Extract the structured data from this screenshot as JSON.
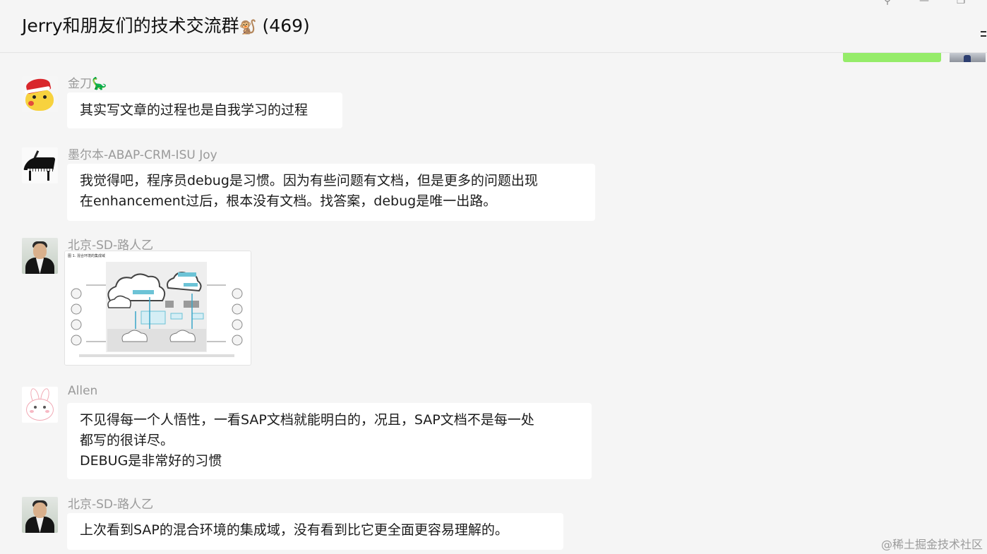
{
  "header": {
    "title": "Jerry和朋友们的技术交流群",
    "emoji": "🐒",
    "member_count": "(469)",
    "controls": {
      "pin": "⚲",
      "minimize": "—",
      "restore": "❐"
    }
  },
  "messages": [
    {
      "sender": "金刀",
      "sender_emoji": "🦕",
      "text": "其实写文章的过程也是自我学习的过程"
    },
    {
      "sender": "墨尔本-ABAP-CRM-ISU Joy",
      "text": "我觉得吧，程序员debug是习惯。因为有些问题有文档，但是更多的问题出现\n在enhancement过后，根本没有文档。找答案，debug是唯一出路。"
    },
    {
      "sender": "北京-SD-路人乙",
      "image_caption": "图 1. 混合环境的集成域"
    },
    {
      "sender": "Allen",
      "text": "不见得每一个人悟性，一看SAP文档就能明白的，况且，SAP文档不是每一处\n都写的很详尽。\nDEBUG是非常好的习惯"
    },
    {
      "sender": "北京-SD-路人乙",
      "text": "上次看到SAP的混合环境的集成域，没有看到比它更全面更容易理解的。"
    }
  ],
  "watermark": "@稀土掘金技术社区",
  "colors": {
    "background": "#f5f5f5",
    "bubble": "#ffffff",
    "self_bubble": "#95ec69",
    "sender_name": "#9a9a9a"
  }
}
